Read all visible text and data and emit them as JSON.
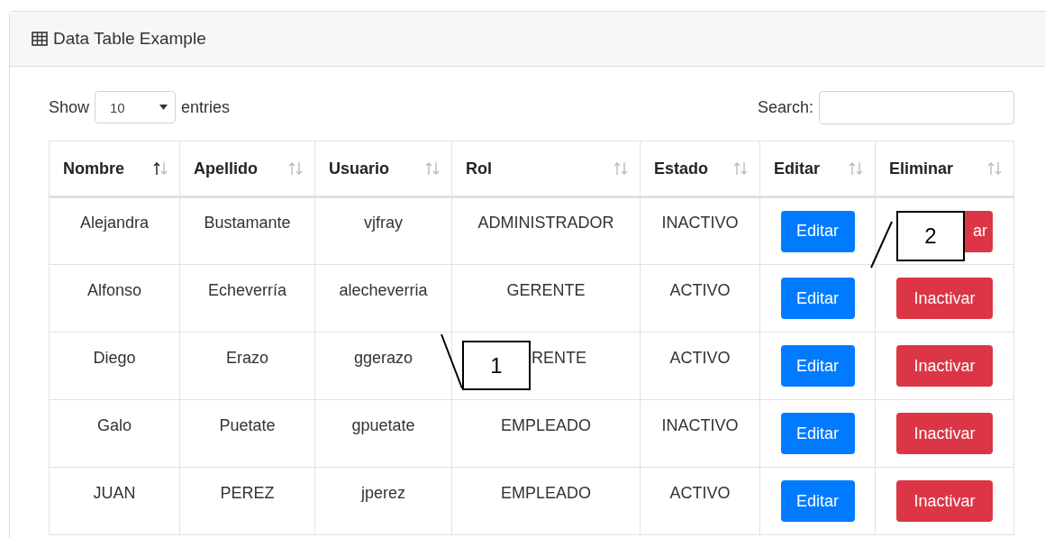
{
  "card": {
    "title": "Data Table Example"
  },
  "length": {
    "label_before": "Show",
    "value": "10",
    "label_after": "entries"
  },
  "search": {
    "label": "Search:"
  },
  "table": {
    "columns": [
      {
        "label": "Nombre",
        "sorted": true
      },
      {
        "label": "Apellido",
        "sorted": false
      },
      {
        "label": "Usuario",
        "sorted": false
      },
      {
        "label": "Rol",
        "sorted": false
      },
      {
        "label": "Estado",
        "sorted": false
      },
      {
        "label": "Editar",
        "sorted": false
      },
      {
        "label": "Eliminar",
        "sorted": false
      }
    ],
    "rows": [
      {
        "cells": [
          "Alejandra",
          "Bustamante",
          "vjfray",
          "ADMINISTRADOR",
          "INACTIVO"
        ],
        "edit": "Editar",
        "delete": "ar",
        "delete_covered": true,
        "rol_covered": false
      },
      {
        "cells": [
          "Alfonso",
          "Echeverría",
          "alecheverria",
          "GERENTE",
          "ACTIVO"
        ],
        "edit": "Editar",
        "delete": "Inactivar",
        "delete_covered": false,
        "rol_covered": false
      },
      {
        "cells": [
          "Diego",
          "Erazo",
          "ggerazo",
          "RENTE",
          "ACTIVO"
        ],
        "edit": "Editar",
        "delete": "Inactivar",
        "delete_covered": false,
        "rol_covered": true
      },
      {
        "cells": [
          "Galo",
          "Puetate",
          "gpuetate",
          "EMPLEADO",
          "INACTIVO"
        ],
        "edit": "Editar",
        "delete": "Inactivar",
        "delete_covered": false,
        "rol_covered": false
      },
      {
        "cells": [
          "JUAN",
          "PEREZ",
          "jperez",
          "EMPLEADO",
          "ACTIVO"
        ],
        "edit": "Editar",
        "delete": "Inactivar",
        "delete_covered": false,
        "rol_covered": false
      }
    ]
  },
  "callouts": [
    {
      "label": "1"
    },
    {
      "label": "2"
    }
  ]
}
